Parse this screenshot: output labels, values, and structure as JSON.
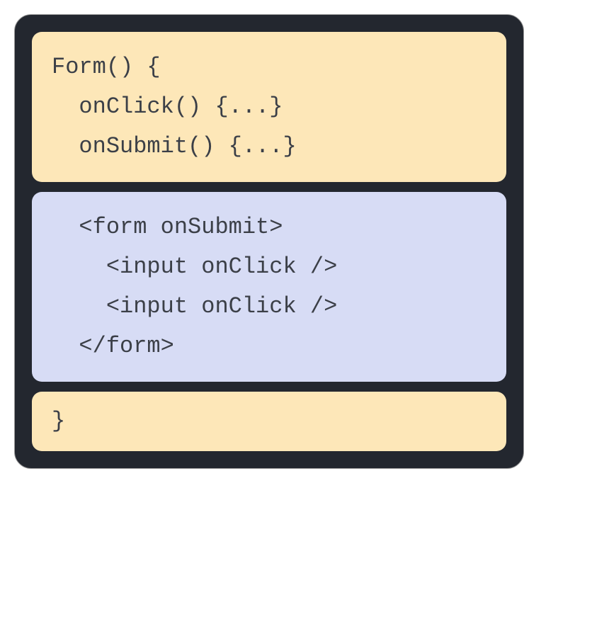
{
  "blocks": {
    "top": {
      "line1": "Form() {",
      "line2": "  onClick() {...}",
      "line3": "  onSubmit() {...}"
    },
    "middle": {
      "line1": "  <form onSubmit>",
      "line2": "    <input onClick />",
      "line3": "    <input onClick />",
      "line4": "  </form>"
    },
    "bottom": {
      "line1": "}"
    }
  }
}
